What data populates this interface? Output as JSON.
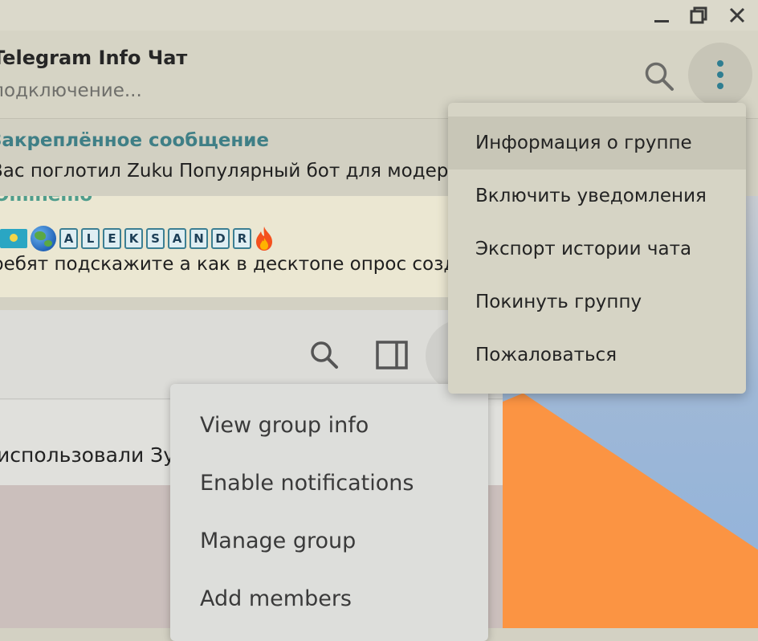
{
  "window": {
    "minimize_icon": "minimize-icon",
    "restore_icon": "restore-icon",
    "close_icon": "close-icon"
  },
  "chat": {
    "title": "Telegram Info Чат",
    "status": "подключение..."
  },
  "pinned": {
    "title": "Закреплённое сообщение",
    "text": "Вас поглотил Zuku  Популярный бот для модерации"
  },
  "message": {
    "author": "Ominemo",
    "name_letters": [
      "A",
      "L",
      "E",
      "K",
      "S",
      "A",
      "N",
      "D",
      "R"
    ],
    "text": "ребят подскажите а как в десктопе опрос создать"
  },
  "lower": {
    "row_text": "использовали Зуку"
  },
  "menu_en": {
    "items": [
      "View group info",
      "Enable notifications",
      "Manage group",
      "Add members"
    ]
  },
  "menu_ru": {
    "items": [
      "Информация о группе",
      "Включить уведомления",
      "Экспорт истории чата",
      "Покинуть группу",
      "Пожаловаться"
    ]
  },
  "colors": {
    "accent_teal": "#3f7f86",
    "author_green": "#4f9d8c",
    "header_bg": "#d6d4c5",
    "orange": "#fb9443"
  }
}
